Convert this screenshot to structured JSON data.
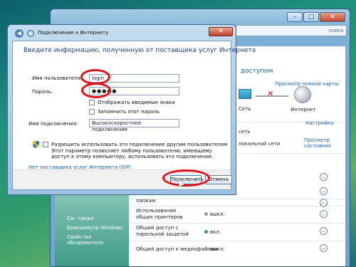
{
  "background_window": {
    "address_hint": "поиск",
    "title_fragment": "доступом",
    "full_map_link": "Просмотр полной карты",
    "net_label": "Сеть",
    "internet_label": "Интернет",
    "network_section": "сеть",
    "settings_link": "Настройка",
    "local_network": "локальной сети",
    "view_status_link": "Просмотр состояния",
    "sharing_rows": [
      {
        "label": "папкам",
        "status": ""
      },
      {
        "label": "Использование общих принтеров",
        "status": "выкл."
      },
      {
        "label": "Общий доступ с парольной защитой",
        "status": "вкл."
      },
      {
        "label": "Общий доступ к медиафайлам",
        "status": "выкл."
      }
    ],
    "see_also": {
      "heading": "См. также",
      "links": [
        "Брандмауэр Windows",
        "Свойства обозревателя"
      ]
    }
  },
  "dialog": {
    "title": "Подключение к Интернету",
    "heading": "Введите информацию, полученную от поставщика услуг Интернета",
    "username_label": "Имя пользователя:",
    "username_value": "login",
    "password_label": "Пароль:",
    "password_value": "●●●●●",
    "show_chars_label": "Отображать вводимые знаки",
    "remember_password_label": "Запомнить этот пароль",
    "connection_name_label": "Имя подключения:",
    "connection_name_value": "Высокоскоростное подключение",
    "allow_others_label": "Разрешить использовать это подключение другим пользователям",
    "allow_others_desc": "Этот параметр позволяет любому пользователю, имеющему доступ к этому компьютеру, использовать это подключение.",
    "no_isp_link": "Нет поставщика услуг Интернета (ISP)",
    "connect_button": "Подключить",
    "cancel_button": "Отмена"
  },
  "colors": {
    "highlight_oval": "#e3101a",
    "link_blue": "#1a5fb4",
    "heading_blue": "#1a3d8f"
  }
}
